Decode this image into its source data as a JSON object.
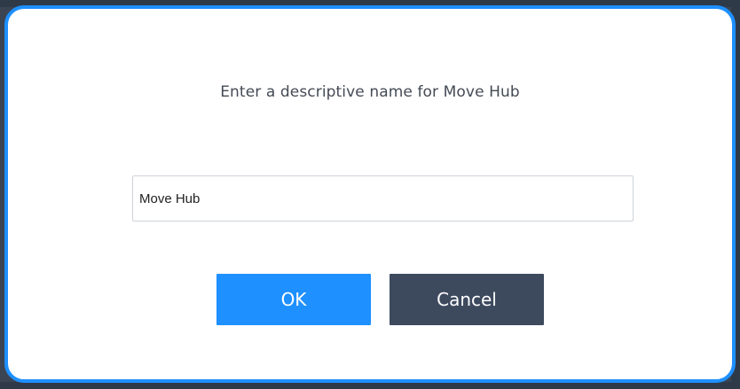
{
  "dialog": {
    "prompt": "Enter a descriptive name for Move Hub",
    "input_value": "Move Hub",
    "ok_label": "OK",
    "cancel_label": "Cancel"
  },
  "colors": {
    "accent": "#1e90ff",
    "cancel": "#3d4a5e",
    "prompt_text": "#444b55"
  }
}
